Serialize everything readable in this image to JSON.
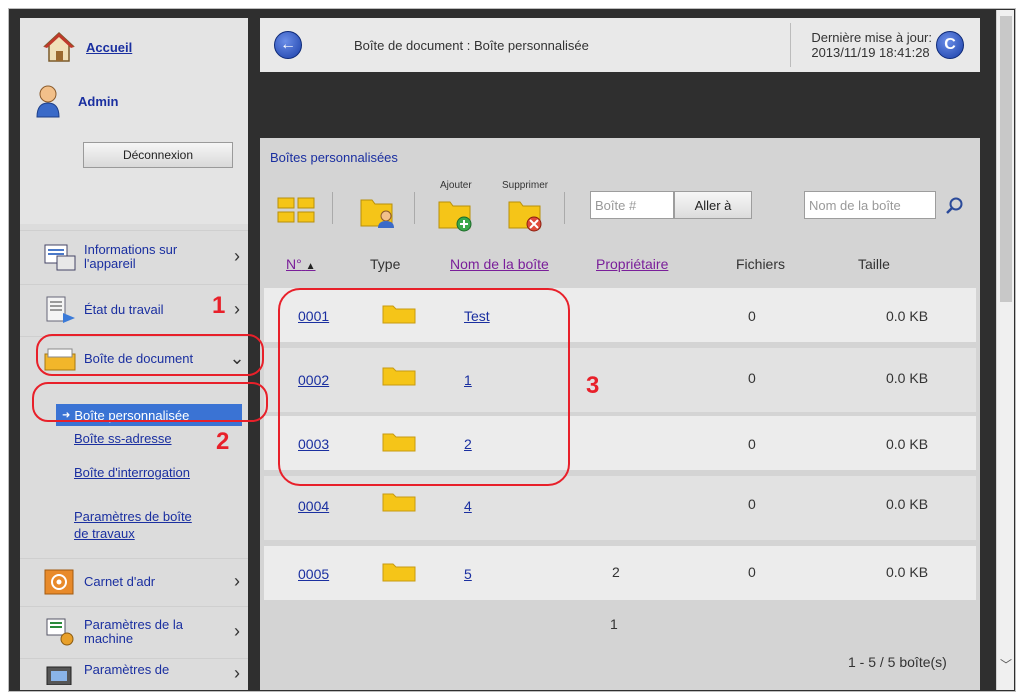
{
  "sidebar": {
    "home_label": "Accueil",
    "user_name": "Admin",
    "logout_label": "Déconnexion",
    "items": [
      {
        "label_line1": "Informations sur",
        "label_line2": "l'appareil",
        "icon": "device-info-icon"
      },
      {
        "label_line1": "État du travail",
        "label_line2": "",
        "icon": "job-status-icon"
      },
      {
        "label_line1": "Boîte de document",
        "label_line2": "",
        "icon": "document-box-icon"
      },
      {
        "label_line1": "Carnet d'adr",
        "label_line2": "",
        "icon": "address-book-icon"
      },
      {
        "label_line1": "Paramètres de la",
        "label_line2": "machine",
        "icon": "machine-settings-icon"
      },
      {
        "label_line1": "Paramètres de",
        "label_line2": "",
        "icon": "settings-icon"
      }
    ],
    "sub_items": {
      "active": "Boîte personnalisée",
      "item2": "Boîte ss-adresse",
      "item3": "Boîte d'interrogation",
      "item4_line1": "Paramètres de boîte",
      "item4_line2": "de travaux"
    }
  },
  "header": {
    "title": "Boîte de document : Boîte personnalisée",
    "update_label": "Dernière mise à jour:",
    "update_time": "2013/11/19 18:41:28"
  },
  "panel": {
    "title": "Boîtes personnalisées",
    "toolbar": {
      "add_label": "Ajouter",
      "delete_label": "Supprimer",
      "box_number_placeholder": "Boîte #",
      "goto_label": "Aller à",
      "box_name_placeholder": "Nom de la boîte"
    },
    "columns": {
      "number": "N°",
      "type": "Type",
      "name": "Nom de la boîte",
      "owner": "Propriétaire",
      "files": "Fichiers",
      "size": "Taille"
    },
    "rows": [
      {
        "number": "0001",
        "name": "Test",
        "owner": "",
        "files": "0",
        "size": "0.0 KB"
      },
      {
        "number": "0002",
        "name": "1",
        "owner": "",
        "files": "0",
        "size": "0.0 KB"
      },
      {
        "number": "0003",
        "name": "2",
        "owner": "",
        "files": "0",
        "size": "0.0 KB"
      },
      {
        "number": "0004",
        "name": "4",
        "owner": "",
        "files": "0",
        "size": "0.0 KB"
      },
      {
        "number": "0005",
        "name": "5",
        "owner": "2",
        "files": "0",
        "size": "0.0 KB"
      }
    ],
    "page": "1",
    "range": "1 - 5 / 5 boîte(s)"
  },
  "annotations": {
    "one": "1",
    "two": "2",
    "three": "3"
  },
  "colors": {
    "link": "#1a2fa0",
    "sort_link": "#7a1f9a",
    "highlight": "#3a73d4",
    "annotation": "#e8202a",
    "folder": "#f5c518"
  }
}
